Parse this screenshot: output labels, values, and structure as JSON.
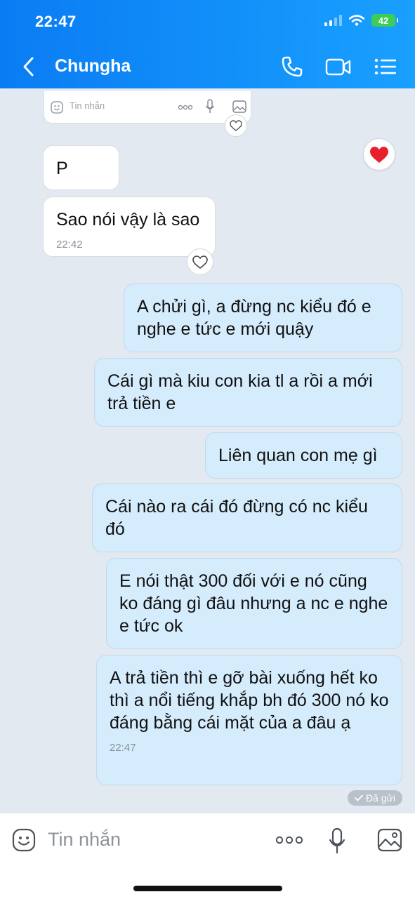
{
  "status_bar": {
    "time": "22:47",
    "battery": "42"
  },
  "header": {
    "title": "Chungha"
  },
  "preview": {
    "placeholder": "Tin nhắn"
  },
  "messages": [
    {
      "side": "in",
      "text": "P"
    },
    {
      "side": "in",
      "text": "Sao nói vậy là sao",
      "time": "22:42"
    },
    {
      "side": "out",
      "text": "A chửi gì, a đừng nc kiểu đó e nghe e tức e mới quậy"
    },
    {
      "side": "out",
      "text": "Cái gì mà kiu con kia tl a rồi a mới trả tiền e"
    },
    {
      "side": "out",
      "text": "Liên quan con mẹ gì"
    },
    {
      "side": "out",
      "text": "Cái nào ra cái đó đừng có nc kiểu đó"
    },
    {
      "side": "out",
      "text": "E nói thật 300 đối với e nó cũng ko đáng gì đâu nhưng a nc e nghe e tức ok"
    },
    {
      "side": "out",
      "text": "A trả tiền thì e gỡ bài xuống hết ko thì a nổi tiếng khắp bh đó 300 nó ko đáng bằng cái mặt của a đâu ạ",
      "time": "22:47"
    }
  ],
  "sent_status": "Đã gửi",
  "input": {
    "placeholder": "Tin nhắn"
  },
  "colors": {
    "header": "#0a7cf3",
    "outgoing_bubble": "#d5ecfd",
    "background": "#e2e9f1",
    "reaction": "#e8202e"
  }
}
